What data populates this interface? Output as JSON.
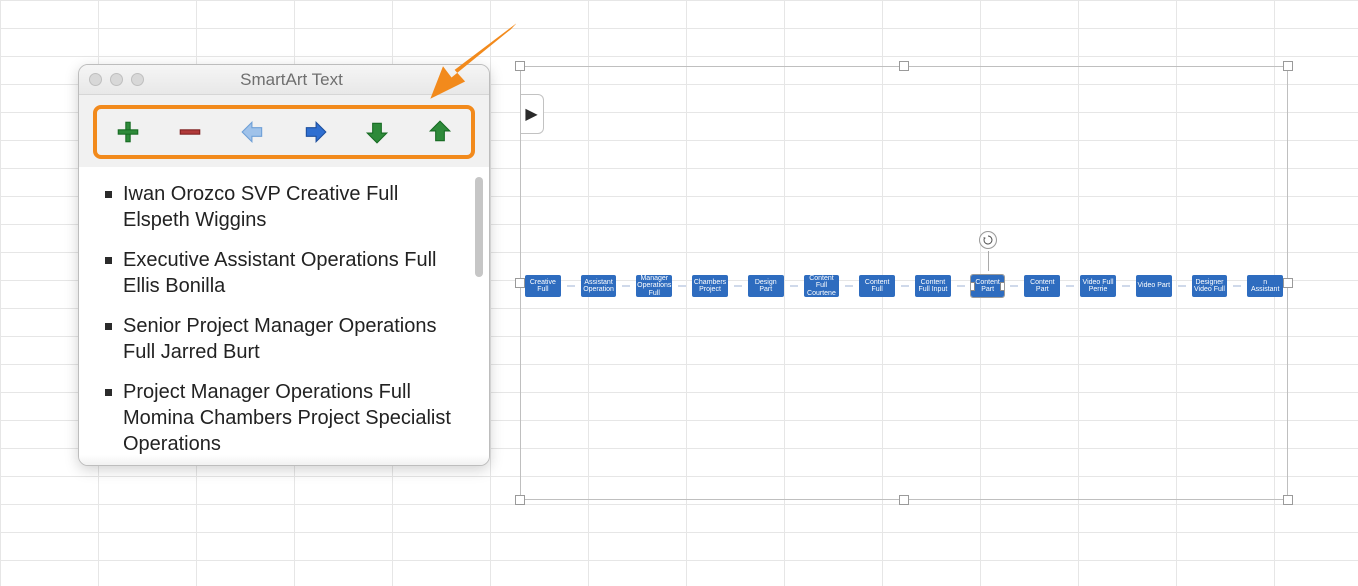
{
  "panel": {
    "title": "SmartArt Text",
    "toolbar": {
      "add_icon": "plus-icon",
      "remove_icon": "minus-icon",
      "outdent_icon": "arrow-left-icon",
      "indent_icon": "arrow-right-icon",
      "move_down_icon": "arrow-down-icon",
      "move_up_icon": "arrow-up-icon"
    },
    "items": [
      "Iwan Orozco  SVP Creative Full Elspeth Wiggins",
      "Executive Assistant Operations Full Ellis Bonilla",
      "Senior Project Manager Operations Full Jarred Burt",
      "Project Manager Operations Full Momina Chambers Project Specialist  Operations"
    ]
  },
  "annotation": {
    "pointer_color": "#f28a1c"
  },
  "smartart": {
    "selected_index": 8,
    "nodes": [
      {
        "label": "Creative Full"
      },
      {
        "label": "Assistant Operation"
      },
      {
        "label": "Manager Operations Full"
      },
      {
        "label": "Chambers Project"
      },
      {
        "label": "Design Part"
      },
      {
        "label": "Content Full Courtene"
      },
      {
        "label": "Content Full"
      },
      {
        "label": "Content Full Input"
      },
      {
        "label": "Content Part"
      },
      {
        "label": "Content Part"
      },
      {
        "label": "Video Full Perrie"
      },
      {
        "label": "Video Part"
      },
      {
        "label": "Designer Video Full"
      },
      {
        "label": "n Assistant"
      }
    ]
  }
}
